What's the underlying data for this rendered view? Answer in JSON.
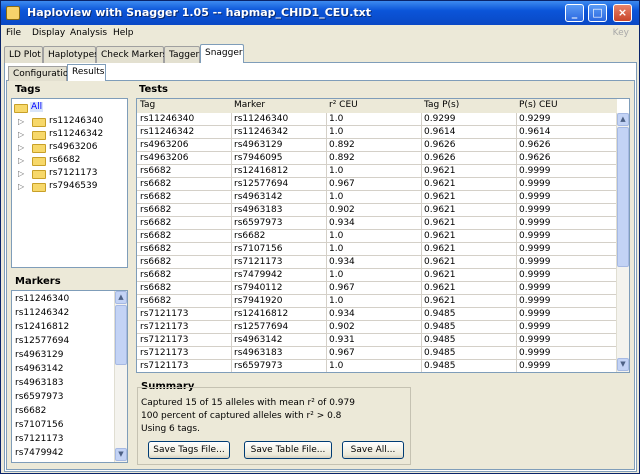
{
  "window": {
    "title": "Haploview with Snagger 1.05 -- hapmap_CHID1_CEU.txt"
  },
  "menu": {
    "items": [
      "File",
      "Display",
      "Analysis",
      "Help"
    ],
    "key_label": "Key"
  },
  "tabs": [
    "LD Plot",
    "Haplotypes",
    "Check Markers",
    "Tagger",
    "Snagger"
  ],
  "subtabs": [
    "Configuration",
    "Results"
  ],
  "tags": {
    "header": "Tags",
    "root": "All",
    "items": [
      "rs11246340",
      "rs11246342",
      "rs4963206",
      "rs6682",
      "rs7121173",
      "rs7946539"
    ]
  },
  "markers": {
    "header": "Markers",
    "items": [
      "rs11246340",
      "rs11246342",
      "rs12416812",
      "rs12577694",
      "rs4963129",
      "rs4963142",
      "rs4963183",
      "rs6597973",
      "rs6682",
      "rs7107156",
      "rs7121173",
      "rs7479942"
    ]
  },
  "tests": {
    "header": "Tests",
    "columns": [
      "Tag",
      "Marker",
      "r² CEU",
      "Tag P(s)",
      "P(s) CEU"
    ],
    "rows": [
      [
        "rs11246340",
        "rs11246340",
        "1.0",
        "0.9299",
        "0.9299"
      ],
      [
        "rs11246342",
        "rs11246342",
        "1.0",
        "0.9614",
        "0.9614"
      ],
      [
        "rs4963206",
        "rs4963129",
        "0.892",
        "0.9626",
        "0.9626"
      ],
      [
        "rs4963206",
        "rs7946095",
        "0.892",
        "0.9626",
        "0.9626"
      ],
      [
        "rs6682",
        "rs12416812",
        "1.0",
        "0.9621",
        "0.9999"
      ],
      [
        "rs6682",
        "rs12577694",
        "0.967",
        "0.9621",
        "0.9999"
      ],
      [
        "rs6682",
        "rs4963142",
        "1.0",
        "0.9621",
        "0.9999"
      ],
      [
        "rs6682",
        "rs4963183",
        "0.902",
        "0.9621",
        "0.9999"
      ],
      [
        "rs6682",
        "rs6597973",
        "0.934",
        "0.9621",
        "0.9999"
      ],
      [
        "rs6682",
        "rs6682",
        "1.0",
        "0.9621",
        "0.9999"
      ],
      [
        "rs6682",
        "rs7107156",
        "1.0",
        "0.9621",
        "0.9999"
      ],
      [
        "rs6682",
        "rs7121173",
        "0.934",
        "0.9621",
        "0.9999"
      ],
      [
        "rs6682",
        "rs7479942",
        "1.0",
        "0.9621",
        "0.9999"
      ],
      [
        "rs6682",
        "rs7940112",
        "0.967",
        "0.9621",
        "0.9999"
      ],
      [
        "rs6682",
        "rs7941920",
        "1.0",
        "0.9621",
        "0.9999"
      ],
      [
        "rs7121173",
        "rs12416812",
        "0.934",
        "0.9485",
        "0.9999"
      ],
      [
        "rs7121173",
        "rs12577694",
        "0.902",
        "0.9485",
        "0.9999"
      ],
      [
        "rs7121173",
        "rs4963142",
        "0.931",
        "0.9485",
        "0.9999"
      ],
      [
        "rs7121173",
        "rs4963183",
        "0.967",
        "0.9485",
        "0.9999"
      ],
      [
        "rs7121173",
        "rs6597973",
        "1.0",
        "0.9485",
        "0.9999"
      ]
    ]
  },
  "summary": {
    "header": "Summary",
    "lines": [
      "Captured 15 of 15 alleles with mean r² of 0.979",
      "100 percent of captured alleles with r² > 0.8",
      "Using 6 tags."
    ],
    "buttons": [
      "Save Tags File...",
      "Save Table File...",
      "Save All..."
    ]
  }
}
